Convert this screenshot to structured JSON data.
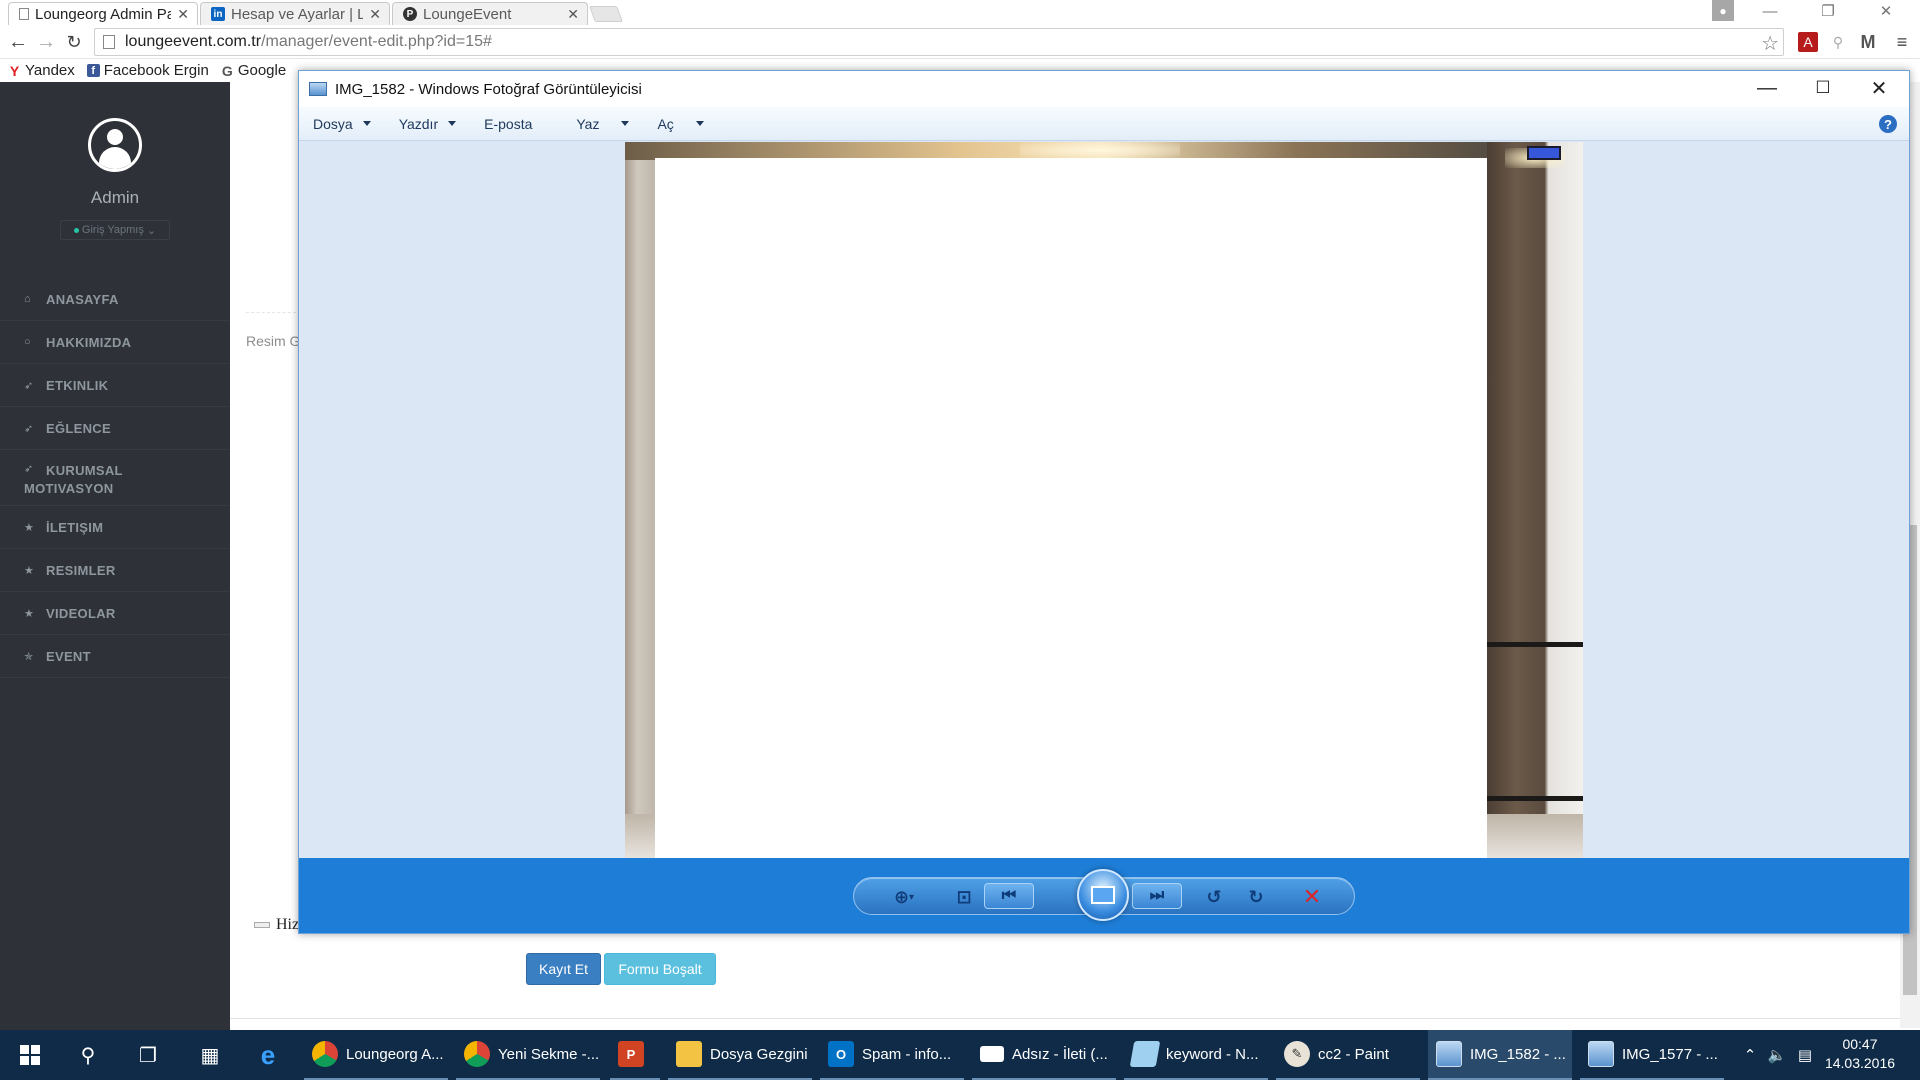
{
  "browser": {
    "tabs": [
      {
        "title": "Loungeorg Admin Pa",
        "favicon": "page-icon",
        "active": true
      },
      {
        "title": "Hesap ve Ayarlar | Lir",
        "favicon": "linkedin-icon",
        "active": false
      },
      {
        "title": "LoungeEvent",
        "favicon": "p-icon",
        "active": false
      }
    ],
    "url_host": "loungeevent.com.tr",
    "url_path": "/manager/event-edit.php?id=15#",
    "bookmarks": [
      "Yandex",
      "Facebook Ergin",
      "Google"
    ]
  },
  "sidebar": {
    "admin_name": "Admin",
    "status": "Giriş Yapmış",
    "items": [
      {
        "label": "ANASAYFA",
        "icon": "home-icon"
      },
      {
        "label": "HAKKIMIZDA",
        "icon": "comment-icon"
      },
      {
        "label": "ETKINLIK",
        "icon": "rocket-icon"
      },
      {
        "label": "EĞLENCE",
        "icon": "rocket-icon"
      },
      {
        "label": "KURUMSAL",
        "label2": "MOTIVASYON",
        "icon": "rocket-icon"
      },
      {
        "label": "İLETIŞIM",
        "icon": "star-icon"
      },
      {
        "label": "RESIMLER",
        "icon": "star-icon"
      },
      {
        "label": "VIDEOLAR",
        "icon": "star-icon"
      },
      {
        "label": "EVENT",
        "icon": "star-outline-icon"
      }
    ]
  },
  "content": {
    "ghost_label": "Resim G",
    "checkbox_label": "Hiz",
    "save_button": "Kayıt Et",
    "reset_button": "Formu Boşalt"
  },
  "viewer": {
    "title": "IMG_1582 - Windows Fotoğraf Görüntüleyicisi",
    "menu": [
      "Dosya",
      "Yazdır",
      "E-posta",
      "Yaz",
      "Aç"
    ],
    "help": "?"
  },
  "taskbar": {
    "apps": [
      {
        "label": "Loungeorg A...",
        "icon": "chrome-icon"
      },
      {
        "label": "Yeni Sekme -...",
        "icon": "chrome-icon"
      },
      {
        "label": "",
        "icon": "powerpoint-icon"
      },
      {
        "label": "Dosya Gezgini",
        "icon": "folder-icon"
      },
      {
        "label": "Spam - info...",
        "icon": "outlook-icon"
      },
      {
        "label": "Adsız - İleti (...",
        "icon": "mail-icon"
      },
      {
        "label": "keyword - N...",
        "icon": "notepad-icon"
      },
      {
        "label": "cc2 - Paint",
        "icon": "paint-icon"
      },
      {
        "label": "IMG_1582 - ...",
        "icon": "photo-viewer-icon"
      },
      {
        "label": "IMG_1577 - ...",
        "icon": "photo-viewer-icon"
      }
    ],
    "time": "00:47",
    "date": "14.03.2016"
  },
  "colors": {
    "sidebar_bg": "#2e3238",
    "viewer_bar": "#1e7dd6",
    "taskbar_bg": "#0f2b47",
    "save_button": "#3a7fc1",
    "reset_button": "#5bc0de"
  }
}
